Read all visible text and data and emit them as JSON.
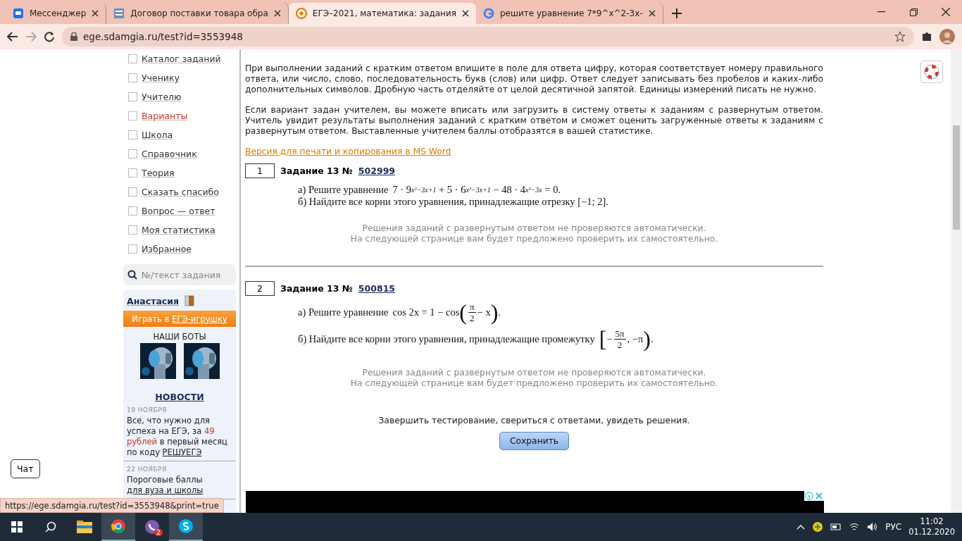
{
  "browser": {
    "tabs": [
      {
        "title": "Мессенджер",
        "selected": false
      },
      {
        "title": "Договор поставки товара обра",
        "selected": false
      },
      {
        "title": "ЕГЭ–2021, математика: задания",
        "selected": true
      },
      {
        "title": "решите уравнение 7*9^x^2-3x-",
        "selected": false
      }
    ],
    "url": "ege.sdamgia.ru/test?id=3553948"
  },
  "sidebar": {
    "menu": [
      {
        "label": "Каталог заданий",
        "highlighted": false,
        "checked": false
      },
      {
        "label": "Ученику",
        "highlighted": false,
        "checked": false
      },
      {
        "label": "Учителю",
        "highlighted": false,
        "checked": false
      },
      {
        "label": "Варианты",
        "highlighted": true,
        "checked": false
      },
      {
        "label": "Школа",
        "highlighted": false,
        "checked": false
      },
      {
        "label": "Справочник",
        "highlighted": false,
        "checked": false
      },
      {
        "label": "Теория",
        "highlighted": false,
        "checked": false
      },
      {
        "label": "Сказать спасибо",
        "highlighted": false,
        "checked": false
      },
      {
        "label": "Вопрос — ответ",
        "highlighted": false,
        "checked": false
      },
      {
        "label": "Моя статистика",
        "highlighted": false,
        "checked": false
      },
      {
        "label": "Избранное",
        "highlighted": false,
        "checked": false
      }
    ],
    "search": {
      "placeholder": "№/текст задания"
    },
    "user": {
      "name": "Анастасия"
    },
    "game_button": {
      "prefix": "Играть в",
      "link": "ЕГЭ-игрушку"
    },
    "bots_title": "НАШИ БОТЫ",
    "news_title": "НОВОСТИ",
    "news": [
      {
        "date": "19 НОЯБРЯ",
        "pieces": [
          {
            "kind": "text",
            "text": "Все, что нужно для успеха на ЕГЭ, за "
          },
          {
            "kind": "accent",
            "text": "49 рублей"
          },
          {
            "kind": "text",
            "text": " в первый месяц по коду "
          },
          {
            "kind": "link",
            "text": "РЕШУЕГЭ"
          }
        ]
      },
      {
        "date": "22 НОЯБРЯ",
        "pieces": [
          {
            "kind": "text",
            "text": "Пороговые баллы "
          },
          {
            "kind": "link",
            "text": "для вуза и школы"
          }
        ]
      }
    ]
  },
  "main": {
    "intro": [
      "При выполнении заданий с кратким ответом впишите в поле для ответа цифру, которая соответствует номеру правильного ответа, или число, слово, последовательность букв (слов) или цифр. Ответ следует записывать без пробелов и каких-либо дополнительных символов. Дробную часть отделяйте от целой десятичной запятой. Единицы измерений писать не нужно.",
      "Если вариант задан учителем, вы можете вписать или загрузить в систему ответы к заданиям с развернутым ответом. Учитель увидит результаты выполнения заданий с кратким ответом и сможет оценить загруженные ответы к заданиям с развернутым ответом. Выставленные учителем баллы отобразятся в вашей статистике."
    ],
    "print_link": "Версия для печати и копирования в MS Word",
    "tasks": [
      {
        "number": "1",
        "title": "Задание 13 №",
        "id": "502999",
        "parts": [
          {
            "label": "а) Решите уравнение",
            "formula": [
              {
                "kind": "text",
                "text": "7 · 9"
              },
              {
                "kind": "sup",
                "text": "x²−3x+1"
              },
              {
                "kind": "text",
                "text": " + 5 · 6"
              },
              {
                "kind": "sup",
                "text": "x²−3x+1"
              },
              {
                "kind": "text",
                "text": " − 48 · 4"
              },
              {
                "kind": "sup",
                "text": "x²−3x"
              },
              {
                "kind": "text",
                "text": " = 0."
              }
            ]
          },
          {
            "label": "б) Найдите все корни этого уравнения, принадлежащие отрезку [−1; 2]."
          }
        ],
        "note": [
          "Решения заданий с развернутым ответом не проверяются автоматически.",
          "На следующей странице вам будет предложено проверить их самостоятельно."
        ]
      },
      {
        "number": "2",
        "title": "Задание 13 №",
        "id": "500815",
        "parts": [
          {
            "label": "а) Решите уравнение",
            "formula": [
              {
                "kind": "text",
                "text": "cos 2x = 1 − cos"
              },
              {
                "kind": "paren",
                "text": "("
              },
              {
                "kind": "frac",
                "num": "π",
                "den": "2"
              },
              {
                "kind": "text",
                "text": "− x"
              },
              {
                "kind": "paren",
                "text": ")"
              },
              {
                "kind": "text",
                "text": "."
              }
            ]
          },
          {
            "label": "б) Найдите все корни этого уравнения, принадлежащие промежутку",
            "formula": [
              {
                "kind": "paren",
                "text": "["
              },
              {
                "kind": "text",
                "text": "−"
              },
              {
                "kind": "frac",
                "num": "5π",
                "den": "2"
              },
              {
                "kind": "text",
                "text": ", −π"
              },
              {
                "kind": "paren",
                "text": ")"
              },
              {
                "kind": "text",
                "text": "."
              }
            ]
          }
        ],
        "note": [
          "Решения заданий с развернутым ответом не проверяются автоматически.",
          "На следующей странице вам будет предложено проверить их самостоятельно."
        ]
      }
    ],
    "finish_text": "Завершить тестирование, свериться с ответами, увидеть решения.",
    "save_button": "Сохранить"
  },
  "chat_button": "Чат",
  "status_url": "https://ege.sdamgia.ru/test?id=3553948&print=true",
  "taskbar": {
    "apps": [
      {
        "active": false
      },
      {
        "active": true
      },
      {
        "active": false,
        "badge": "2"
      },
      {
        "active": true
      }
    ],
    "language": "РУС",
    "time": "11:02",
    "date": "01.12.2020"
  }
}
